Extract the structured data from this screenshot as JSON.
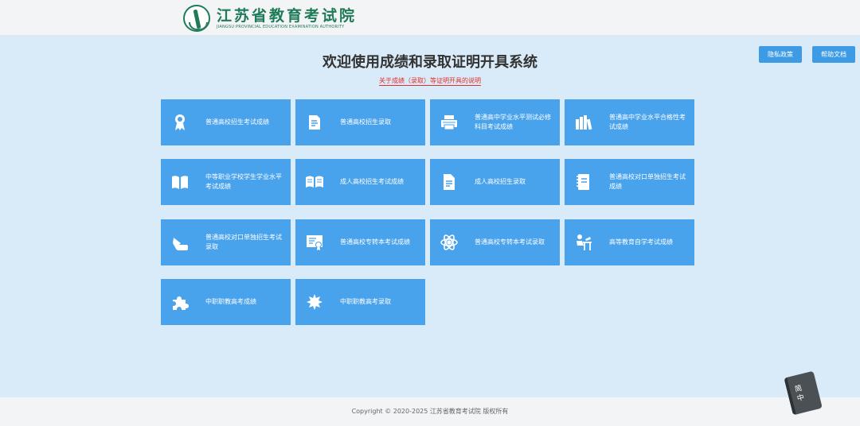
{
  "header": {
    "logo_cn": "江苏省教育考试院",
    "logo_en": "JIANGSU PROVINCIAL EDUCATION EXAMINATION AUTHORITY"
  },
  "buttons": {
    "privacy": "隐私政策",
    "help": "帮助文档"
  },
  "main": {
    "title": "欢迎使用成绩和录取证明开具系统",
    "notice": "关于成绩（录取）等证明开具的说明"
  },
  "tiles": [
    {
      "label": "普通高校招生考试成绩",
      "icon": "award-icon"
    },
    {
      "label": "普通高校招生录取",
      "icon": "document-icon"
    },
    {
      "label": "普通高中学业水平测试必修科目考试成绩",
      "icon": "printer-icon"
    },
    {
      "label": "普通高中学业水平合格性考试成绩",
      "icon": "books-icon"
    },
    {
      "label": "中等职业学校学生学业水平考试成绩",
      "icon": "open-book-icon"
    },
    {
      "label": "成人高校招生考试成绩",
      "icon": "reading-book-icon"
    },
    {
      "label": "成人高校招生录取",
      "icon": "file-icon"
    },
    {
      "label": "普通高校对口单独招生考试成绩",
      "icon": "notebook-icon"
    },
    {
      "label": "普通高校对口单独招生考试录取",
      "icon": "pointing-hand-icon"
    },
    {
      "label": "普通高校专转本考试成绩",
      "icon": "certificate-icon"
    },
    {
      "label": "普通高校专转本考试录取",
      "icon": "atom-icon"
    },
    {
      "label": "高等教育自学考试成绩",
      "icon": "student-desk-icon"
    },
    {
      "label": "中职职教高考成绩",
      "icon": "puzzle-icon"
    },
    {
      "label": "中职职教高考录取",
      "icon": "leaf-icon"
    }
  ],
  "footer": {
    "copyright": "Copyright © 2020-2025 江苏省教育考试院 版权所有"
  },
  "badge": {
    "text1": "简",
    "text2": "中"
  }
}
